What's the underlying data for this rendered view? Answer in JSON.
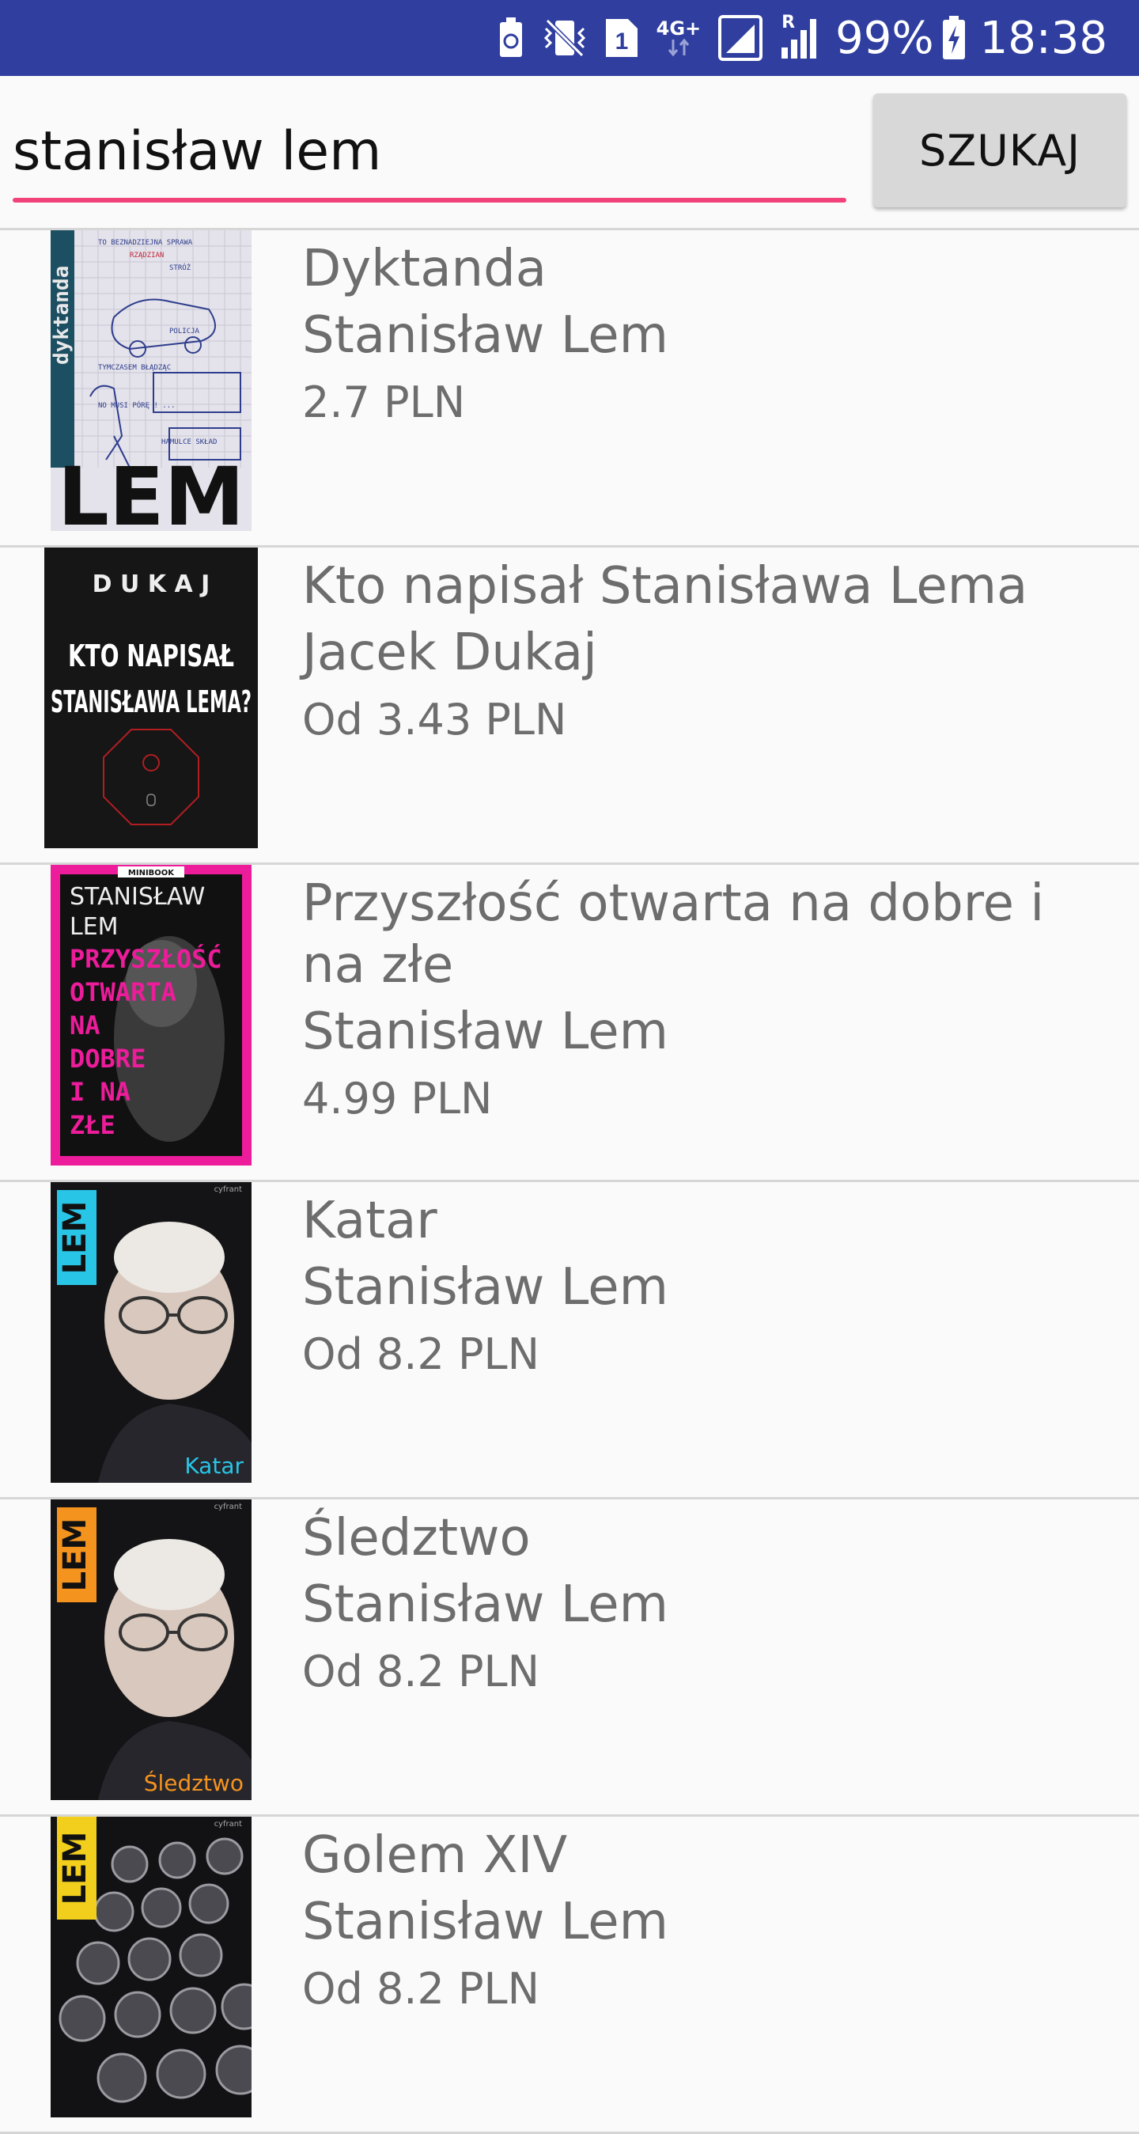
{
  "status_bar": {
    "battery_percent": "99%",
    "time": "18:38",
    "sim_label": "1",
    "network_label": "4G+",
    "roaming_label": "R",
    "icons": [
      "battery-saver-icon",
      "vibrate-icon",
      "sim-icon",
      "data-arrows-icon",
      "signal-icon",
      "signal-roaming-icon",
      "battery-charging-icon"
    ],
    "background_color": "#303f9f"
  },
  "search": {
    "value": "stanisław lem",
    "button_label": "SZUKAJ",
    "accent_color": "#f2427a"
  },
  "results": [
    {
      "title": "Dyktanda",
      "author": "Stanisław Lem",
      "price": "2.7 PLN",
      "cover": {
        "side_text": "dyktanda",
        "big_text": "LEM",
        "notes": [
          "TO BEZNADZIEJNA SPRAWA",
          "RZĄDZIAN",
          "STRÓŻ",
          "POLICJA",
          "TYMCZASEM BŁĄDZĄC",
          "NO MUSI PÓRĘ ! ...",
          "HAMULCE SKŁAD"
        ]
      }
    },
    {
      "title": "Kto napisał Stanisława Lema",
      "author": "Jacek Dukaj",
      "price": "Od 3.43 PLN",
      "cover": {
        "top_text": "D U K A J",
        "line1": "KTO NAPISAŁ",
        "line2": "STANISŁAWA LEMA?"
      }
    },
    {
      "title": "Przyszłość otwarta na dobre i na złe",
      "author": "Stanisław Lem",
      "price": "4.99 PLN",
      "cover": {
        "top_label": "MINIBOOK",
        "author_lines": [
          "STANISŁAW",
          "LEM"
        ],
        "title_lines": [
          "PRZYSZŁOŚĆ",
          "OTWARTA",
          "NA",
          "DOBRE",
          "I NA",
          "ZŁE"
        ]
      }
    },
    {
      "title": "Katar",
      "author": "Stanisław Lem",
      "price": "Od 8.2 PLN",
      "cover": {
        "side_text": "LEM",
        "corner_text": "Katar",
        "publisher": "cyfrant",
        "accent": "#29c5e6"
      }
    },
    {
      "title": "Śledztwo",
      "author": "Stanisław Lem",
      "price": "Od 8.2 PLN",
      "cover": {
        "side_text": "LEM",
        "corner_text": "Śledztwo",
        "publisher": "cyfrant",
        "accent": "#f5931f"
      }
    },
    {
      "title": "Golem XIV",
      "author": "Stanisław Lem",
      "price": "Od 8.2 PLN",
      "cover": {
        "side_text": "LEM",
        "publisher": "cyfrant",
        "accent": "#f2cf1d"
      }
    }
  ]
}
